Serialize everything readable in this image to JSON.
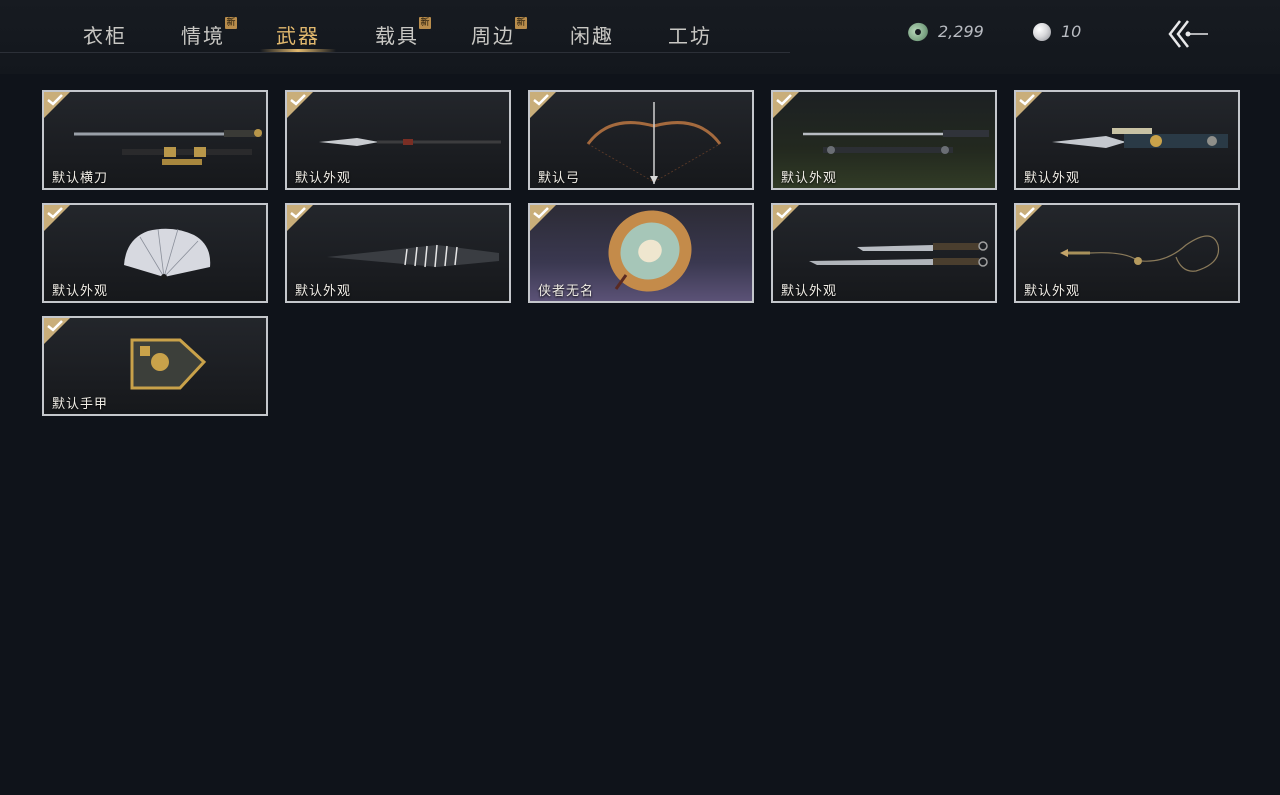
{
  "tabs": [
    {
      "label": "衣柜",
      "badge": ""
    },
    {
      "label": "情境",
      "badge": "新"
    },
    {
      "label": "武器",
      "badge": ""
    },
    {
      "label": "载具",
      "badge": "新"
    },
    {
      "label": "周边",
      "badge": "新"
    },
    {
      "label": "闲趣",
      "badge": ""
    },
    {
      "label": "工坊",
      "badge": ""
    }
  ],
  "active_tab": "武器",
  "currency": {
    "jade": {
      "icon": "jade-coin-icon",
      "amount": "2,299"
    },
    "pearl": {
      "icon": "pearl-icon",
      "amount": "10"
    }
  },
  "items": [
    {
      "label": "默认横刀",
      "icon": "sword-icon",
      "selected": true
    },
    {
      "label": "默认外观",
      "icon": "glaive-icon",
      "selected": true
    },
    {
      "label": "默认弓",
      "icon": "bow-icon",
      "selected": true
    },
    {
      "label": "默认外观",
      "icon": "twin-swords-icon",
      "selected": true
    },
    {
      "label": "默认外观",
      "icon": "ornate-blade-icon",
      "selected": true
    },
    {
      "label": "默认外观",
      "icon": "fan-icon",
      "selected": true
    },
    {
      "label": "默认外观",
      "icon": "striped-spear-icon",
      "selected": true
    },
    {
      "label": "侠者无名",
      "icon": "umbrella-icon",
      "selected": true
    },
    {
      "label": "默认外观",
      "icon": "dual-dao-icon",
      "selected": true
    },
    {
      "label": "默认外观",
      "icon": "rope-dart-icon",
      "selected": true
    },
    {
      "label": "默认手甲",
      "icon": "gauntlet-icon",
      "selected": true
    }
  ]
}
